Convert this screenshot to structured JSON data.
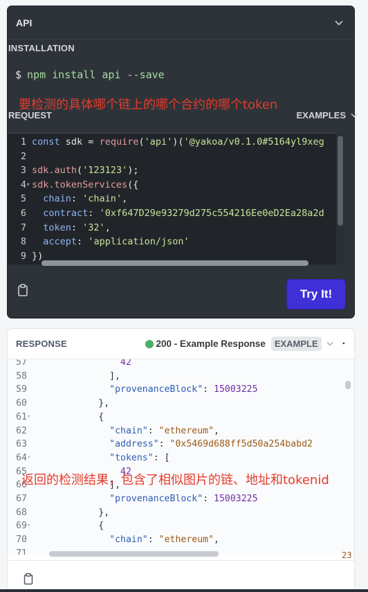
{
  "api_header": {
    "title": "API"
  },
  "installation": {
    "label": "INSTALLATION",
    "prompt": "$",
    "command": "npm install api --save"
  },
  "annotation_request": "要检测的具体哪个链上的哪个合约的哪个token",
  "request": {
    "label": "REQUEST",
    "examples_label": "EXAMPLES",
    "code": [
      {
        "n": "1",
        "segs": [
          [
            "kw",
            "const "
          ],
          [
            "src",
            "sdk = "
          ],
          [
            "fn",
            "require"
          ],
          [
            "src",
            "("
          ],
          [
            "str",
            "'api'"
          ],
          [
            "src",
            ")("
          ],
          [
            "str",
            "'@yakoa/v0.1.0#5164yl9xeg"
          ]
        ]
      },
      {
        "n": "2",
        "segs": []
      },
      {
        "n": "3",
        "segs": [
          [
            "fn",
            "sdk.auth"
          ],
          [
            "src",
            "("
          ],
          [
            "str",
            "'123123'"
          ],
          [
            "src",
            ");"
          ]
        ]
      },
      {
        "n": "4",
        "segs": [
          [
            "fn",
            "sdk.tokenServices"
          ],
          [
            "src",
            "({"
          ]
        ],
        "fold": true
      },
      {
        "n": "5",
        "segs": [
          [
            "src",
            "  "
          ],
          [
            "prop",
            "chain"
          ],
          [
            "src",
            ": "
          ],
          [
            "str",
            "'chain'"
          ],
          [
            "src",
            ","
          ]
        ]
      },
      {
        "n": "6",
        "segs": [
          [
            "src",
            "  "
          ],
          [
            "prop",
            "contract"
          ],
          [
            "src",
            ": "
          ],
          [
            "str",
            "'0xf647D29e93279d275c554216Ee0eD2Ea28a2d"
          ]
        ]
      },
      {
        "n": "7",
        "segs": [
          [
            "src",
            "  "
          ],
          [
            "prop",
            "token"
          ],
          [
            "src",
            ": "
          ],
          [
            "str",
            "'32'"
          ],
          [
            "src",
            ","
          ]
        ]
      },
      {
        "n": "8",
        "segs": [
          [
            "src",
            "  "
          ],
          [
            "prop",
            "accept"
          ],
          [
            "src",
            ": "
          ],
          [
            "str",
            "'application/json'"
          ]
        ]
      },
      {
        "n": "9",
        "segs": [
          [
            "src",
            "})"
          ]
        ]
      }
    ]
  },
  "try_button": "Try It!",
  "response": {
    "label": "RESPONSE",
    "status": "200 - Example Response",
    "badge": "EXAMPLE",
    "more": "·",
    "right_number": "23",
    "code": [
      {
        "n": "57",
        "segs": [
          [
            "src",
            "                "
          ],
          [
            "nv",
            "42"
          ]
        ]
      },
      {
        "n": "58",
        "segs": [
          [
            "src",
            "              ],"
          ]
        ]
      },
      {
        "n": "59",
        "segs": [
          [
            "src",
            "              "
          ],
          [
            "key",
            "\"provenanceBlock\""
          ],
          [
            "src",
            ": "
          ],
          [
            "nv",
            "15003225"
          ]
        ]
      },
      {
        "n": "60",
        "segs": [
          [
            "src",
            "            },"
          ]
        ]
      },
      {
        "n": "61",
        "segs": [
          [
            "src",
            "            {"
          ]
        ],
        "fold": true
      },
      {
        "n": "62",
        "segs": [
          [
            "src",
            "              "
          ],
          [
            "key",
            "\"chain\""
          ],
          [
            "src",
            ": "
          ],
          [
            "sv",
            "\"ethereum\""
          ],
          [
            "src",
            ","
          ]
        ]
      },
      {
        "n": "63",
        "segs": [
          [
            "src",
            "              "
          ],
          [
            "key",
            "\"address\""
          ],
          [
            "src",
            ": "
          ],
          [
            "sv",
            "\"0x5469d688ff5d50a254babd2"
          ]
        ]
      },
      {
        "n": "64",
        "segs": [
          [
            "src",
            "              "
          ],
          [
            "key",
            "\"tokens\""
          ],
          [
            "src",
            ": ["
          ]
        ],
        "fold": true
      },
      {
        "n": "65",
        "segs": [
          [
            "src",
            "                "
          ],
          [
            "nv",
            "42"
          ]
        ]
      },
      {
        "n": "66",
        "segs": [
          [
            "src",
            "              ],"
          ]
        ]
      },
      {
        "n": "67",
        "segs": [
          [
            "src",
            "              "
          ],
          [
            "key",
            "\"provenanceBlock\""
          ],
          [
            "src",
            ": "
          ],
          [
            "nv",
            "15003225"
          ]
        ]
      },
      {
        "n": "68",
        "segs": [
          [
            "src",
            "            },"
          ]
        ]
      },
      {
        "n": "69",
        "segs": [
          [
            "src",
            "            {"
          ]
        ],
        "fold": true
      },
      {
        "n": "70",
        "segs": [
          [
            "src",
            "              "
          ],
          [
            "key",
            "\"chain\""
          ],
          [
            "src",
            ": "
          ],
          [
            "sv",
            "\"ethereum\""
          ],
          [
            "src",
            ","
          ]
        ]
      },
      {
        "n": "71",
        "segs": []
      }
    ]
  },
  "annotation_response": "返回的检测结果，包含了相似图片的链、地址和tokenid",
  "colors": {
    "dark_bg": "#2d3339",
    "button": "#3f2fd6",
    "annotation": "#e43b2b",
    "status_dot": "#4caf62"
  },
  "icons": {
    "api_chevron": "chevron-down-icon",
    "examples_chevron": "chevron-down-icon",
    "copy_request": "clipboard-icon",
    "copy_response": "clipboard-icon"
  }
}
